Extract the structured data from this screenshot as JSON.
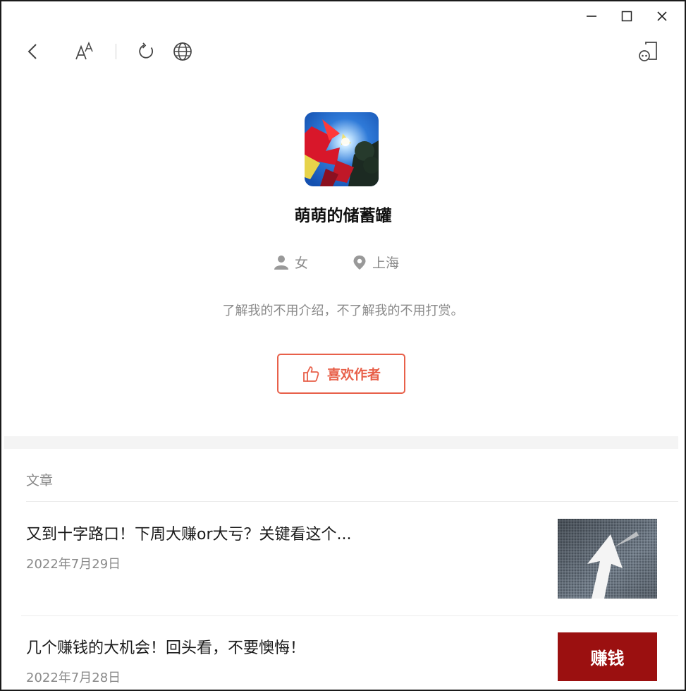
{
  "window": {
    "controls": [
      "minimize-icon",
      "maximize-icon",
      "close-icon"
    ]
  },
  "toolbar": {
    "icons": [
      "back-icon",
      "font-size-icon",
      "refresh-icon",
      "globe-icon",
      "share-icon"
    ]
  },
  "profile": {
    "name": "萌萌的储蓄罐",
    "gender": "女",
    "city": "上海",
    "bio": "了解我的不用介绍，不了解我的不用打赏。",
    "like_button": "喜欢作者"
  },
  "articles_section": {
    "title": "文章",
    "items": [
      {
        "title": "又到十字路口！下周大赚or大亏？关键看这个...",
        "date": "2022年7月29日",
        "thumb": "arrow-road-image"
      },
      {
        "title": "几个赚钱的大机会！回头看，不要懊悔！",
        "date": "2022年7月28日",
        "thumb_text": "赚钱"
      }
    ]
  },
  "colors": {
    "accent": "#e8604a",
    "thumb_red": "#9b1010",
    "muted": "#8a8a8a"
  }
}
